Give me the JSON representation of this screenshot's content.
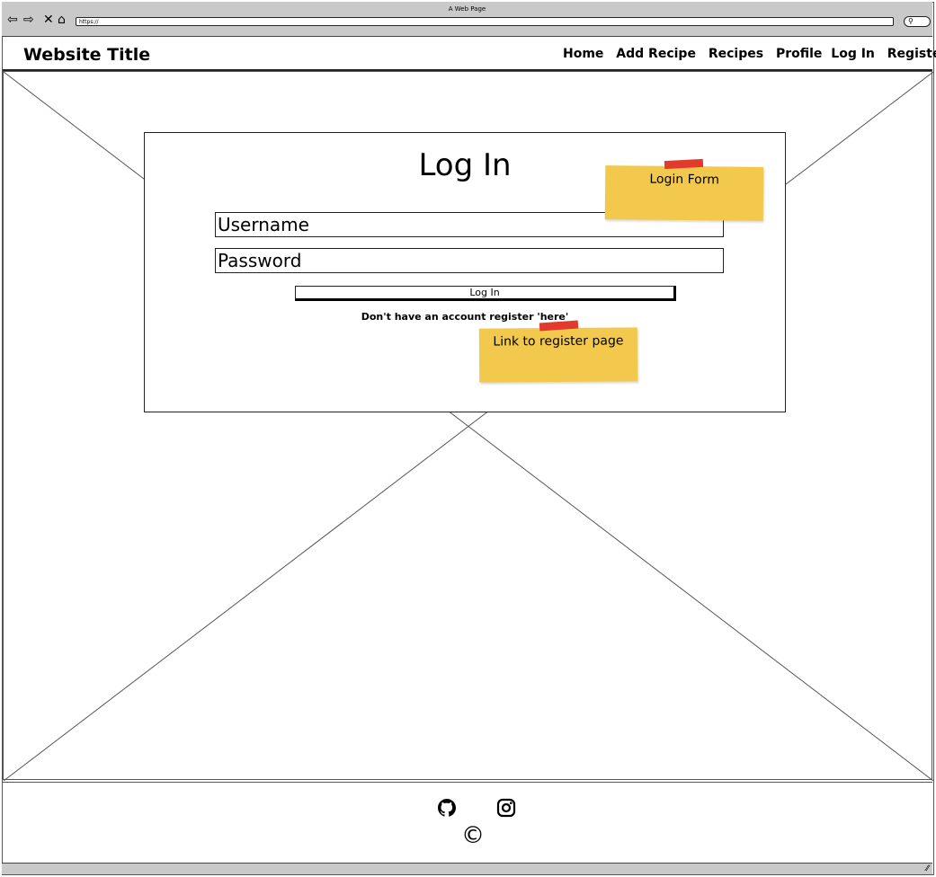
{
  "browser": {
    "title": "A Web Page",
    "url": "https://"
  },
  "header": {
    "site_title": "Website Title",
    "nav": [
      "Home",
      "Add Recipe",
      "Recipes",
      "Profile",
      "Log In",
      "Register"
    ]
  },
  "form": {
    "title": "Log In",
    "username_placeholder": "Username",
    "password_placeholder": "Password",
    "submit_label": "Log In",
    "register_text": "Don't have an account register 'here'"
  },
  "notes": {
    "form_note": "Login Form",
    "register_note": "Link to register page"
  },
  "footer": {
    "copyright": "©",
    "icons": [
      "github-icon",
      "instagram-icon"
    ]
  },
  "colors": {
    "note": "#f2c94c",
    "tape": "#e23b2e",
    "chrome": "#c9c9c9"
  }
}
